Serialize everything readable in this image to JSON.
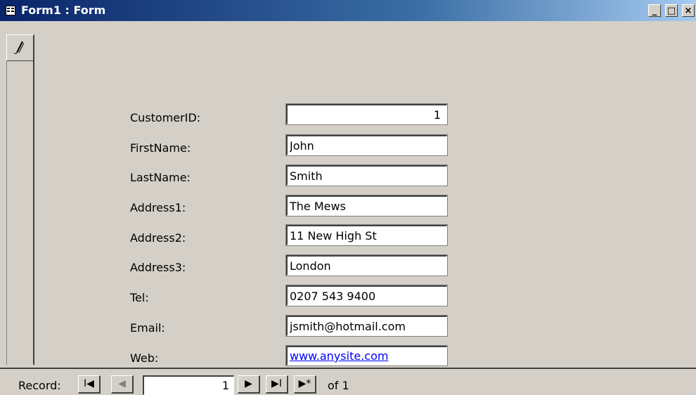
{
  "window": {
    "title": "Form1 : Form",
    "min_glyph": "_",
    "max_glyph": "□",
    "close_glyph": "×"
  },
  "form": {
    "fields": [
      {
        "label": "CustomerID:",
        "value": "1",
        "align": "right"
      },
      {
        "label": "FirstName:",
        "value": "John"
      },
      {
        "label": "LastName:",
        "value": "Smith"
      },
      {
        "label": "Address1:",
        "value": "The Mews"
      },
      {
        "label": "Address2:",
        "value": "11 New High St"
      },
      {
        "label": "Address3:",
        "value": "London"
      },
      {
        "label": "Tel:",
        "value": "0207 543 9400"
      },
      {
        "label": "Email:",
        "value": "jsmith@hotmail.com"
      },
      {
        "label": "Web:",
        "value": "www.anysite.com",
        "is_link": true
      }
    ]
  },
  "navigation": {
    "record_label": "Record:",
    "first_glyph": "I◀",
    "prev_glyph": "◀",
    "current_record": "1",
    "next_glyph": "▶",
    "last_glyph": "▶I",
    "new_glyph": "▶*",
    "of_text": "of 1"
  },
  "colors": {
    "titlebar_start": "#0a246a",
    "titlebar_end": "#a6caf0",
    "face": "#d4d0c8",
    "link": "#0000ff"
  }
}
